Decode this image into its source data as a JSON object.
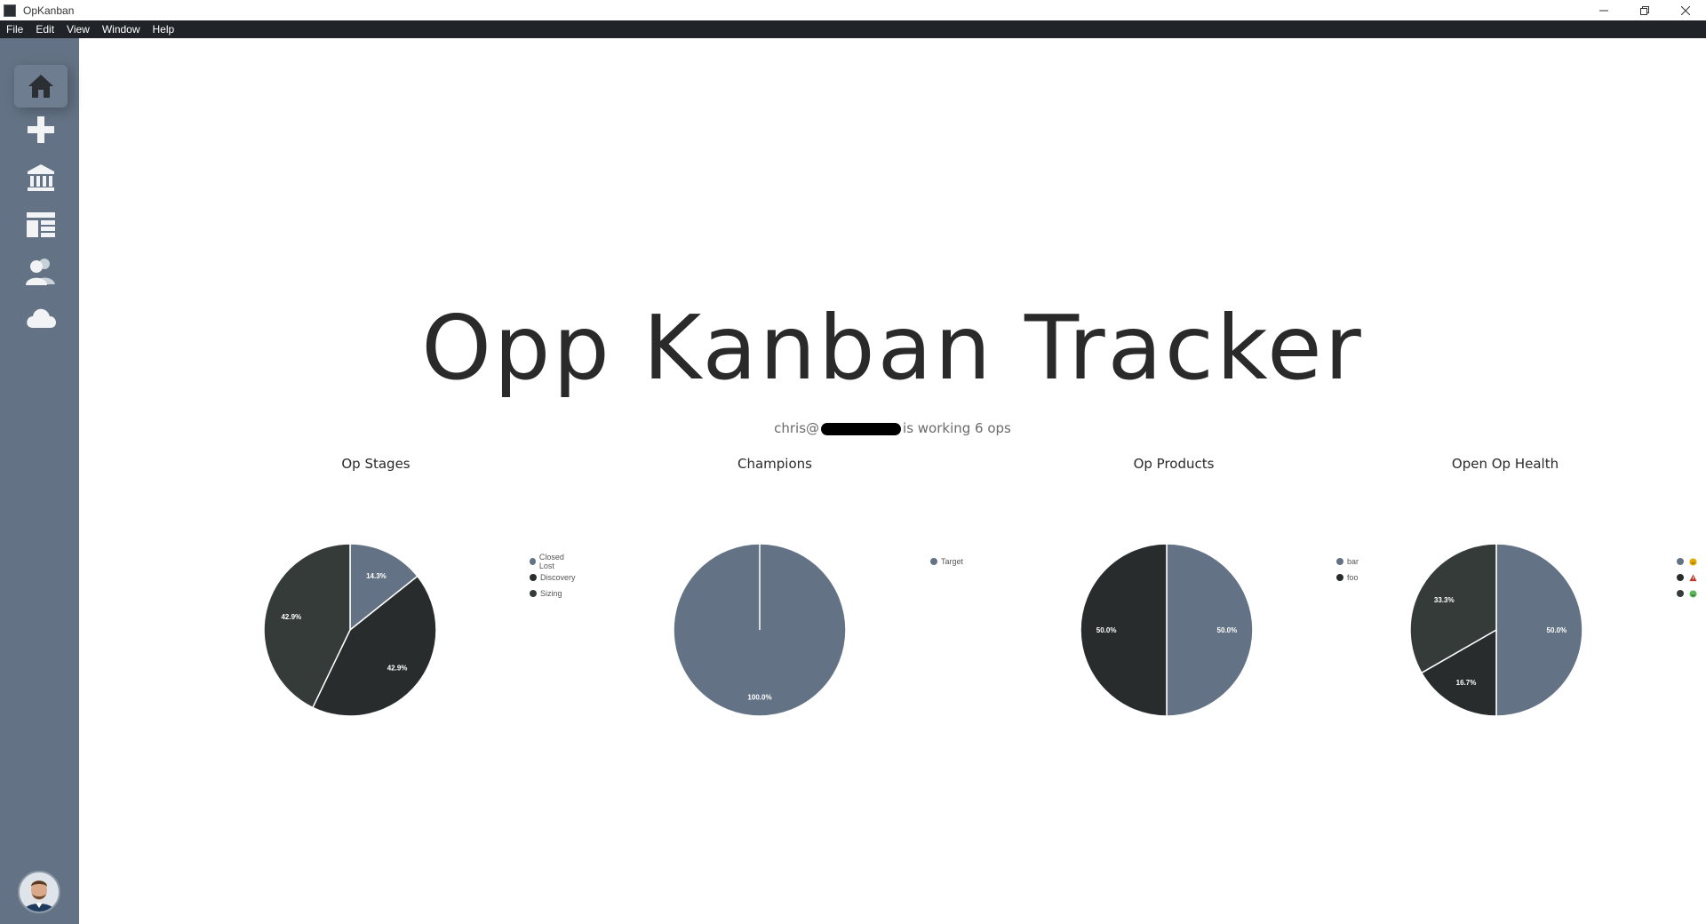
{
  "window": {
    "title": "OpKanban",
    "controls": [
      "minimize-icon",
      "restore-icon",
      "close-icon"
    ]
  },
  "menu": [
    "File",
    "Edit",
    "View",
    "Window",
    "Help"
  ],
  "sidebar": {
    "items": [
      {
        "name": "home-icon",
        "active": true
      },
      {
        "name": "plus-icon",
        "active": false
      },
      {
        "name": "building-icon",
        "active": false
      },
      {
        "name": "dashboard-list-icon",
        "active": false
      },
      {
        "name": "users-icon",
        "active": false
      },
      {
        "name": "cloud-icon",
        "active": false
      }
    ],
    "avatar": "user-avatar"
  },
  "main": {
    "title": "Opp Kanban Tracker",
    "subtitle_prefix": "chris@",
    "subtitle_suffix": "is working 6 ops"
  },
  "colors": {
    "slate": "#637385",
    "dark": "#292c2c",
    "darkgreen": "#343b39",
    "sidebar": "#637385"
  },
  "chart_data": [
    {
      "type": "pie",
      "title": "Op Stages",
      "categories": [
        "Closed Lost",
        "Discovery",
        "Sizing"
      ],
      "values": [
        14.3,
        42.9,
        42.9
      ],
      "labels": [
        "14.3%",
        "42.9%",
        "42.9%"
      ],
      "colors": [
        "#637385",
        "#292c2c",
        "#343b39"
      ],
      "legend": "right"
    },
    {
      "type": "pie",
      "title": "Champions",
      "categories": [
        "Target"
      ],
      "values": [
        100.0
      ],
      "labels": [
        "100.0%"
      ],
      "colors": [
        "#637385"
      ],
      "legend": "right"
    },
    {
      "type": "pie",
      "title": "Op Products",
      "categories": [
        "bar",
        "foo"
      ],
      "values": [
        50.0,
        50.0
      ],
      "labels": [
        "50.0%",
        "50.0%"
      ],
      "colors": [
        "#637385",
        "#292c2c"
      ],
      "legend": "right"
    },
    {
      "type": "pie",
      "title": "Open Op Health",
      "categories": [
        "neutral-emoji-icon",
        "warning-emoji-icon",
        "happy-emoji-icon"
      ],
      "values": [
        50.0,
        16.7,
        33.3
      ],
      "labels": [
        "50.0%",
        "16.7%",
        "33.3%"
      ],
      "colors": [
        "#637385",
        "#292c2c",
        "#343b39"
      ],
      "legend_emoji_colors": [
        "#e0a800",
        "#c0392b",
        "#5cb85c"
      ],
      "legend": "right"
    }
  ]
}
